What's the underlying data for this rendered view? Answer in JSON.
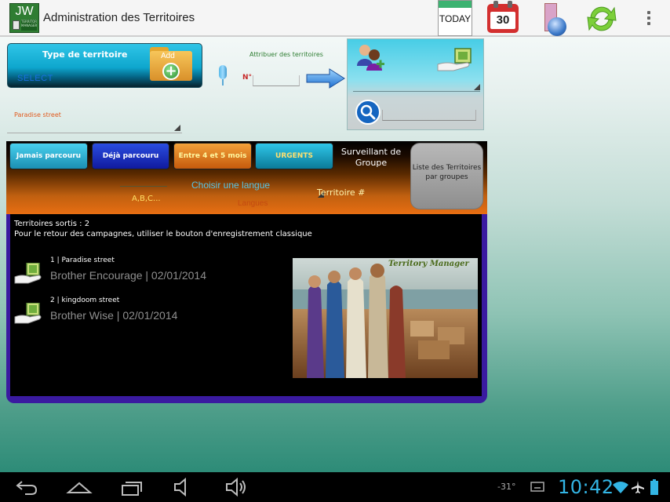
{
  "header": {
    "app_logo_text": "JW",
    "app_logo_sub": "TERRITORY MANAGER",
    "title": "Administration des Territoires",
    "today_label": "TODAY",
    "calendar_day": "30"
  },
  "form": {
    "type_label": "Type de territoire",
    "type_select": "SELECT",
    "add_label": "Add",
    "street_value": "Paradise street",
    "attribuer_label": "Attribuer des territoires",
    "number_label": "N°"
  },
  "filters": {
    "jamais": "Jamais parcouru",
    "deja": "Déjà parcouru",
    "entre": "Entre 4 et 5 mois",
    "urgents": "URGENTS",
    "surveillant": "Surveillant de Groupe",
    "liste": "Liste des Territoires par groupes",
    "abc": "A,B,C...",
    "langue_title": "Choisir une langue",
    "langue_sub": "Langues",
    "territoire_num": "Territoire #"
  },
  "list": {
    "sortis": "Territoires sortis : 2",
    "retour": "Pour le retour des campagnes, utiliser le bouton d'enregistrement classique",
    "items": [
      {
        "line1": "1  |  Paradise street",
        "line2": "Brother Encourage  |  02/01/2014"
      },
      {
        "line1": "2  |  kingdoom street",
        "line2": "Brother Wise  |  02/01/2014"
      }
    ],
    "painting_title": "Territory Manager"
  },
  "status": {
    "temperature": "-31°",
    "time": "10:42"
  },
  "colors": {
    "accent_blue": "#33b5e5",
    "orange": "#e86e12",
    "panel_purple": "#3a1aa0"
  }
}
